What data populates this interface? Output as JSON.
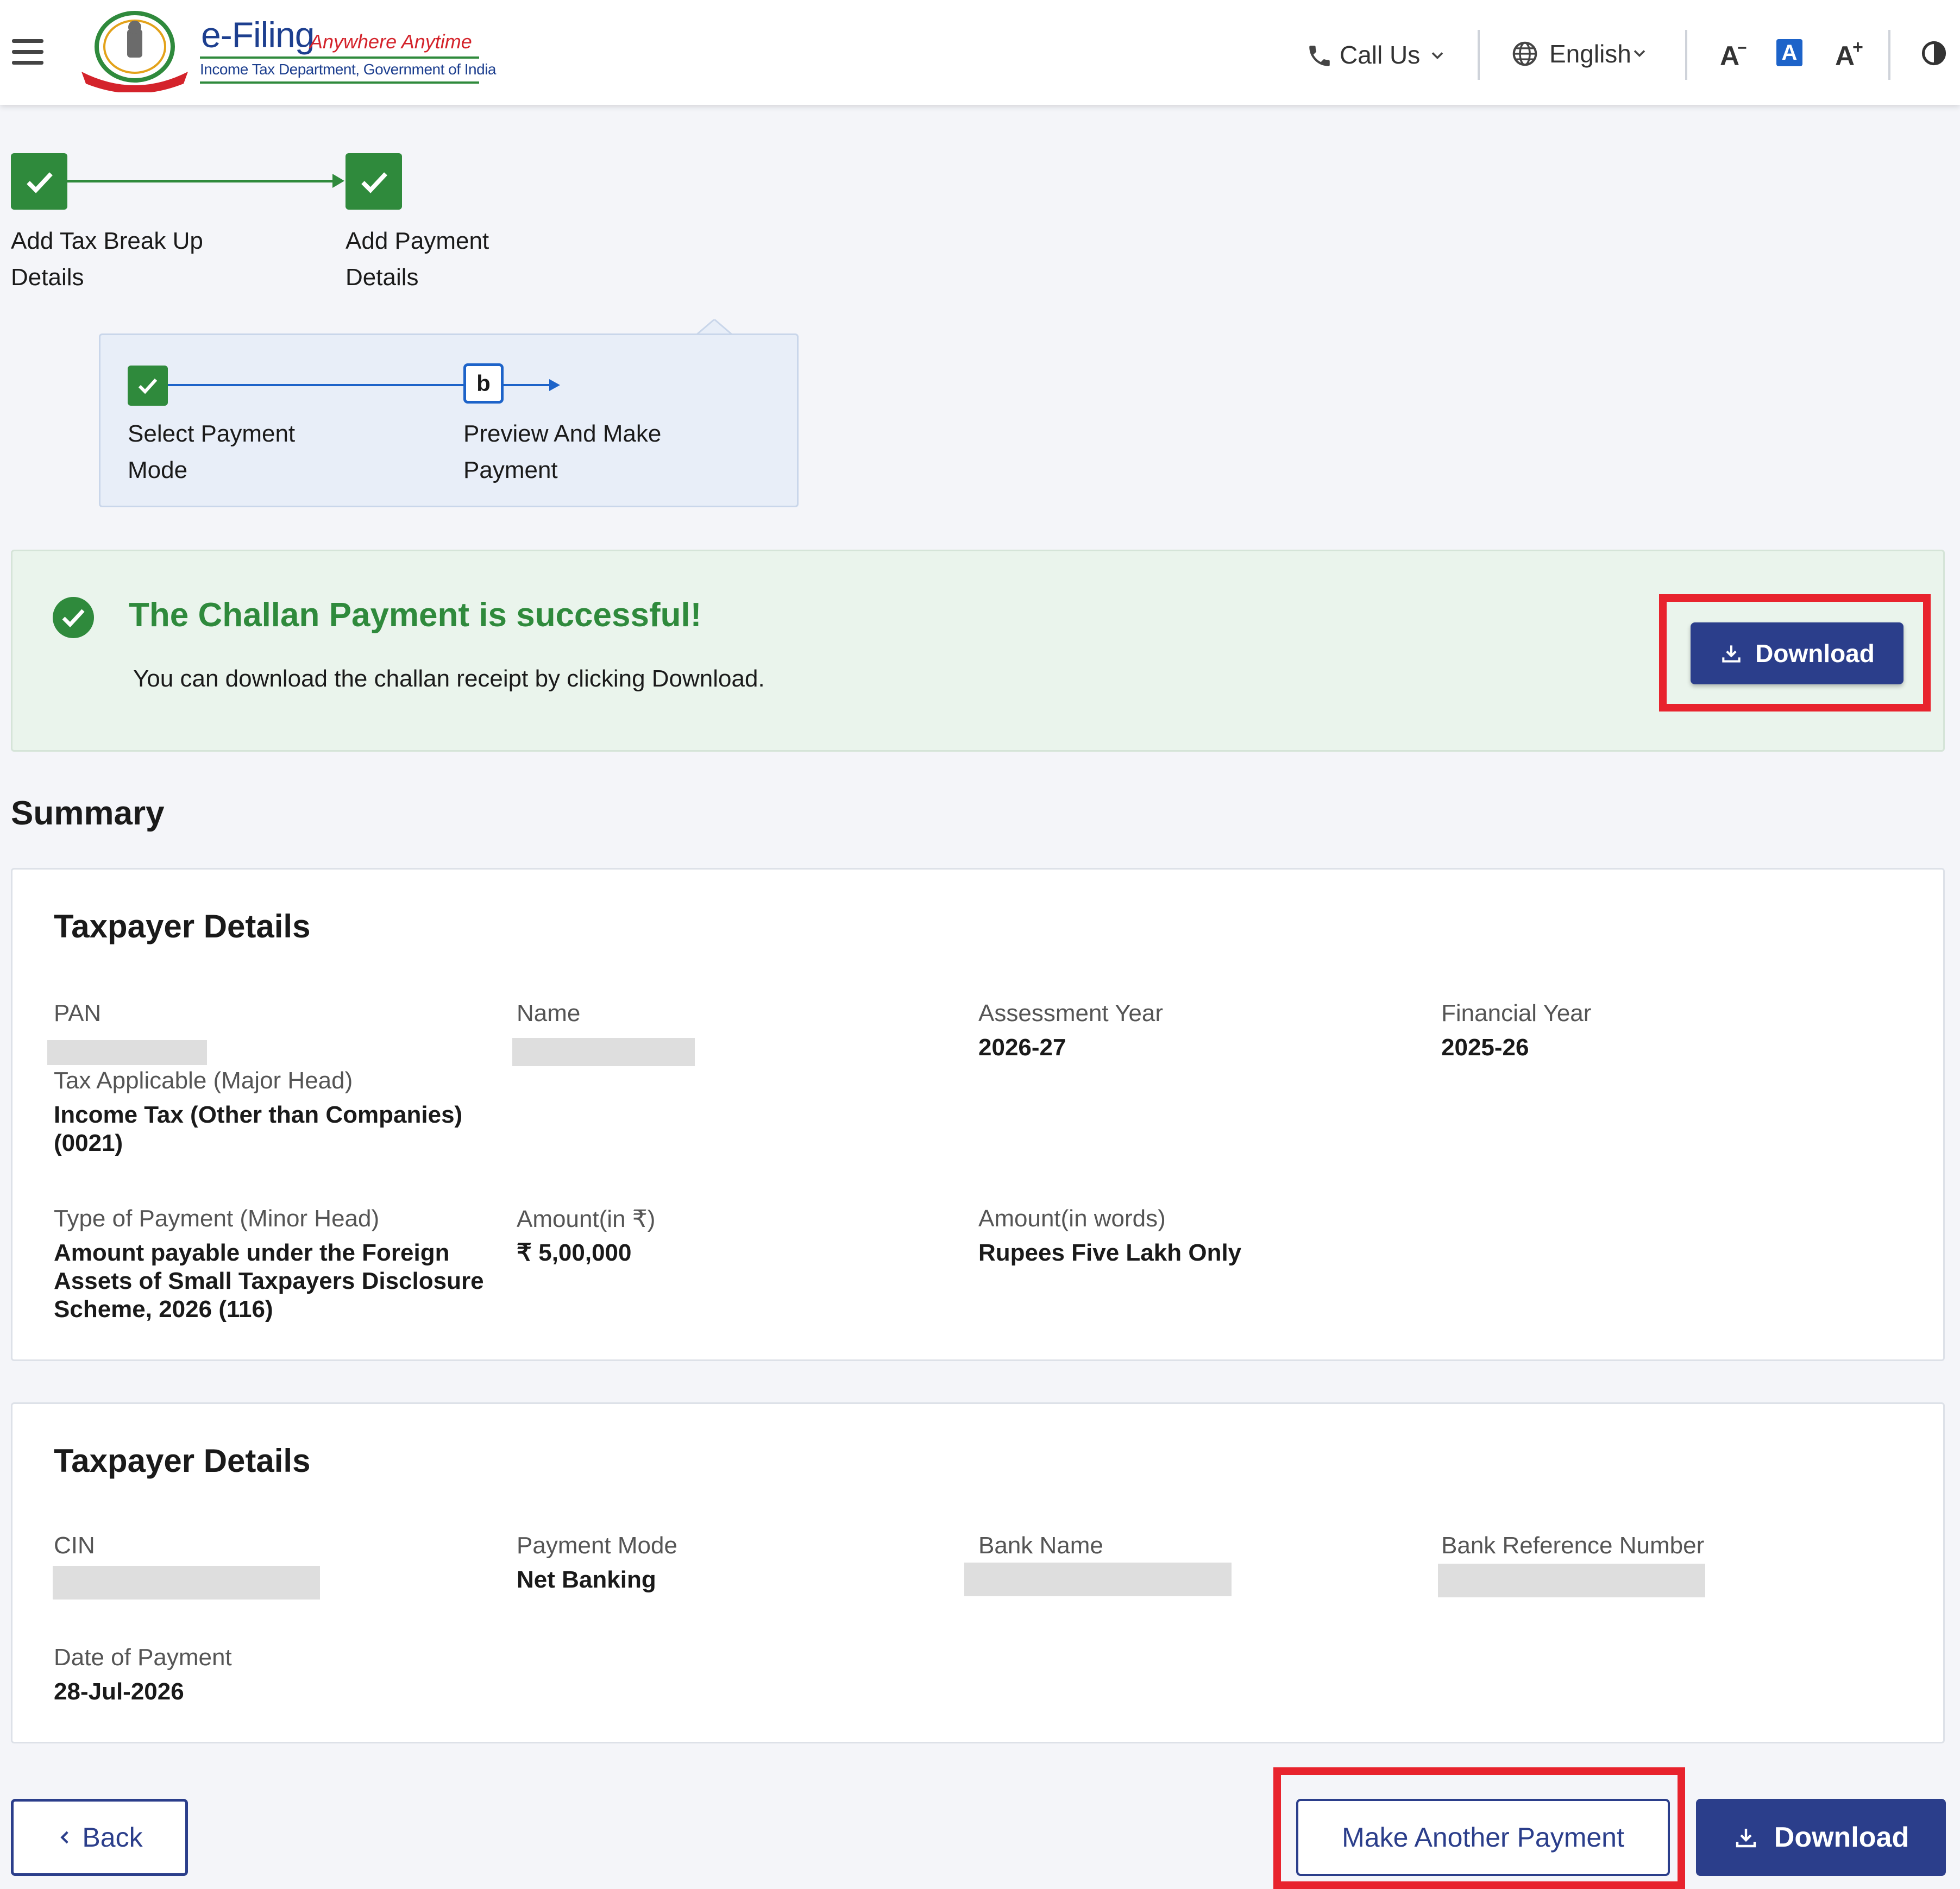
{
  "header": {
    "logo": {
      "title": "e-Filing",
      "tagline": "Anywhere Anytime",
      "subtitle": "Income Tax Department, Government of India"
    },
    "call_us": "Call Us",
    "language": "English",
    "font_decrease": "A",
    "font_reset": "A",
    "font_increase": "A"
  },
  "stepper": {
    "steps": [
      {
        "label_line1": "Add Tax Break Up",
        "label_line2": "Details"
      },
      {
        "label_line1": "Add Payment",
        "label_line2": "Details"
      }
    ],
    "substeps": [
      {
        "label_line1": "Select Payment",
        "label_line2": "Mode"
      },
      {
        "marker": "b",
        "label_line1": "Preview And Make",
        "label_line2": "Payment"
      }
    ]
  },
  "banner": {
    "title": "The Challan Payment is successful!",
    "message": "You can download the challan receipt by clicking Download.",
    "download_label": "Download"
  },
  "summary": {
    "heading": "Summary",
    "taxpayer_card": {
      "title": "Taxpayer Details",
      "pan_label": "PAN",
      "name_label": "Name",
      "ay_label": "Assessment Year",
      "ay_value": "2026-27",
      "fy_label": "Financial Year",
      "fy_value": "2025-26",
      "major_head_label": "Tax Applicable (Major Head)",
      "major_head_value_line1": "Income Tax (Other than Companies)",
      "major_head_value_line2": "(0021)",
      "minor_head_label": "Type of Payment (Minor Head)",
      "minor_head_value_line1": "Amount payable under the Foreign",
      "minor_head_value_line2": "Assets of Small Taxpayers Disclosure",
      "minor_head_value_line3": "Scheme, 2026 (116)",
      "amount_label": "Amount(in ₹)",
      "amount_value": "₹ 5,00,000",
      "amount_words_label": "Amount(in words)",
      "amount_words_value": "Rupees Five Lakh Only"
    },
    "payment_card": {
      "title": "Taxpayer Details",
      "cin_label": "CIN",
      "mode_label": "Payment Mode",
      "mode_value": "Net Banking",
      "bank_label": "Bank Name",
      "ref_label": "Bank Reference Number",
      "date_label": "Date of Payment",
      "date_value": "28-Jul-2026"
    }
  },
  "footer": {
    "back_label": "Back",
    "another_label": "Make Another Payment",
    "download_label": "Download"
  },
  "colors": {
    "primary": "#2b3e8b",
    "success": "#2f8a3c",
    "highlight": "#e8232d",
    "banner_bg": "#eaf4ec"
  }
}
